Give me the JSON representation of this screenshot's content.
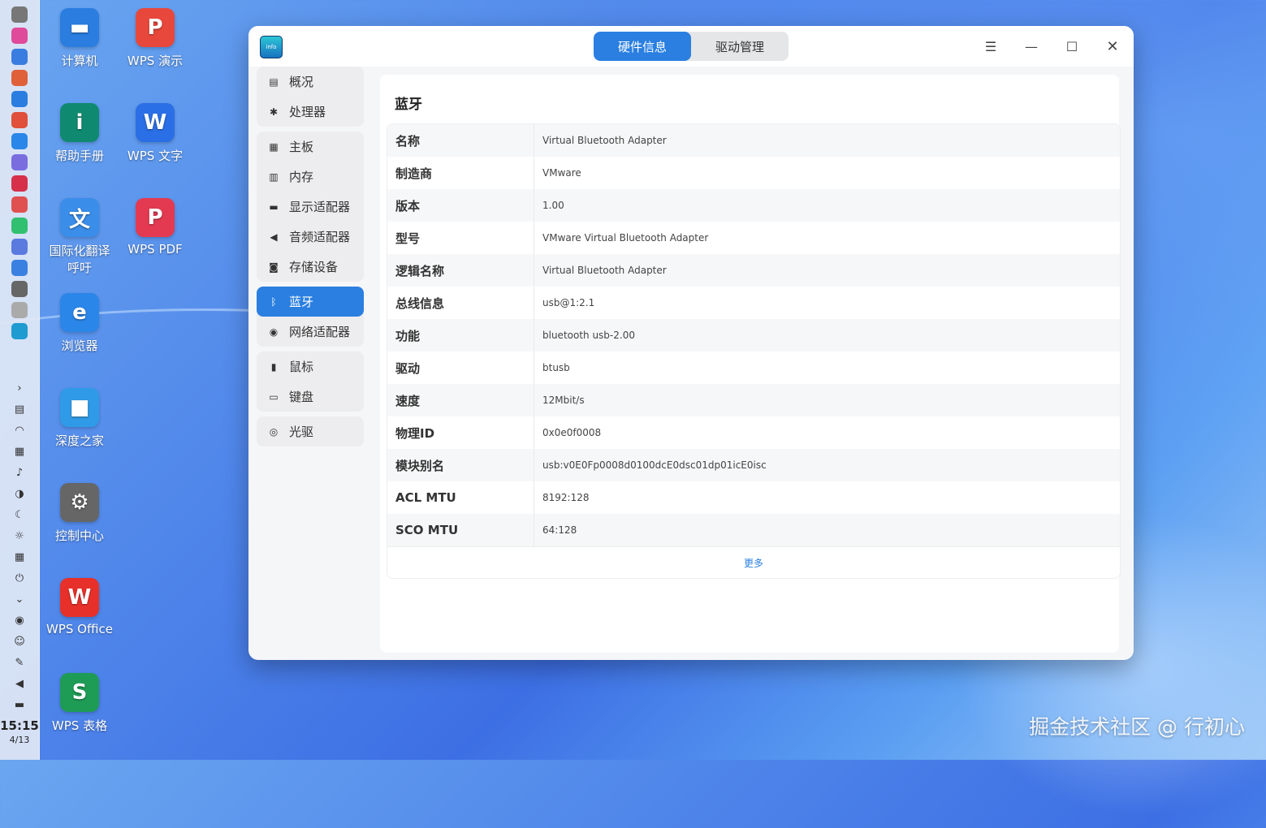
{
  "desktop": {
    "icons": [
      {
        "label": "计算机",
        "glyph": "▬",
        "color": "#2b7de0"
      },
      {
        "label": "WPS 演示",
        "glyph": "P",
        "color": "#e8483c"
      },
      {
        "label": "帮助手册",
        "glyph": "i",
        "color": "#0f8a70"
      },
      {
        "label": "WPS 文字",
        "glyph": "W",
        "color": "#2b6fe6"
      },
      {
        "label": "国际化翻译\n呼吁",
        "glyph": "文",
        "color": "#3a8de8"
      },
      {
        "label": "WPS PDF",
        "glyph": "P",
        "color": "#e33a52"
      },
      {
        "label": "浏览器",
        "glyph": "e",
        "color": "#2a86e8"
      },
      {
        "label": "深度之家",
        "glyph": "■",
        "color": "#2f9be8"
      },
      {
        "label": "控制中心",
        "glyph": "⚙",
        "color": "#666666"
      },
      {
        "label": "WPS Office",
        "glyph": "W",
        "color": "#e8302a"
      },
      {
        "label": "WPS 表格",
        "glyph": "S",
        "color": "#1e9b55"
      }
    ],
    "watermark": "掘金技术社区 @ 行初心"
  },
  "dock": {
    "time": "15:15",
    "date": "4/13",
    "apps": [
      "launcher-icon",
      "music-icon",
      "search-icon",
      "appstore-icon",
      "files-icon",
      "store-icon",
      "browser-icon",
      "mail-icon",
      "terminal-icon",
      "calendar-icon",
      "music-player-icon",
      "chat-icon",
      "window-icon",
      "settings-icon",
      "usb-icon",
      "device-manager-icon"
    ],
    "tray": [
      "chevron-right-icon",
      "notes-icon",
      "wifi-icon",
      "keyboard-icon",
      "notification-icon",
      "theme-icon",
      "moon-icon",
      "brightness-icon",
      "keyboard-layout-icon",
      "power-icon",
      "download-icon",
      "record-icon",
      "screenshot-icon",
      "pen-icon",
      "volume-icon",
      "toggle-icon"
    ]
  },
  "window": {
    "tabs": [
      {
        "label": "硬件信息"
      },
      {
        "label": "驱动管理"
      }
    ],
    "sidebar": [
      [
        {
          "icon": "▤",
          "label": "概况"
        },
        {
          "icon": "✱",
          "label": "处理器"
        }
      ],
      [
        {
          "icon": "▦",
          "label": "主板"
        },
        {
          "icon": "▥",
          "label": "内存"
        },
        {
          "icon": "▬",
          "label": "显示适配器"
        },
        {
          "icon": "◀",
          "label": "音频适配器"
        },
        {
          "icon": "◙",
          "label": "存储设备"
        }
      ],
      [
        {
          "icon": "ᛒ",
          "label": "蓝牙",
          "active": true
        },
        {
          "icon": "◉",
          "label": "网络适配器"
        }
      ],
      [
        {
          "icon": "▮",
          "label": "鼠标"
        },
        {
          "icon": "▭",
          "label": "键盘"
        }
      ],
      [
        {
          "icon": "◎",
          "label": "光驱"
        }
      ]
    ],
    "content": {
      "title": "蓝牙",
      "rows": [
        {
          "k": "名称",
          "v": "Virtual Bluetooth Adapter"
        },
        {
          "k": "制造商",
          "v": "VMware"
        },
        {
          "k": "版本",
          "v": "1.00"
        },
        {
          "k": "型号",
          "v": "VMware Virtual Bluetooth Adapter"
        },
        {
          "k": "逻辑名称",
          "v": "Virtual Bluetooth Adapter"
        },
        {
          "k": "总线信息",
          "v": "usb@1:2.1"
        },
        {
          "k": "功能",
          "v": "bluetooth usb-2.00"
        },
        {
          "k": "驱动",
          "v": "btusb"
        },
        {
          "k": "速度",
          "v": "12Mbit/s"
        },
        {
          "k": "物理ID",
          "v": "0x0e0f0008"
        },
        {
          "k": "模块别名",
          "v": "usb:v0E0Fp0008d0100dcE0dsc01dp01icE0isc"
        },
        {
          "k": "ACL MTU",
          "v": "8192:128"
        },
        {
          "k": "SCO MTU",
          "v": "64:128"
        }
      ],
      "more": "更多"
    }
  }
}
